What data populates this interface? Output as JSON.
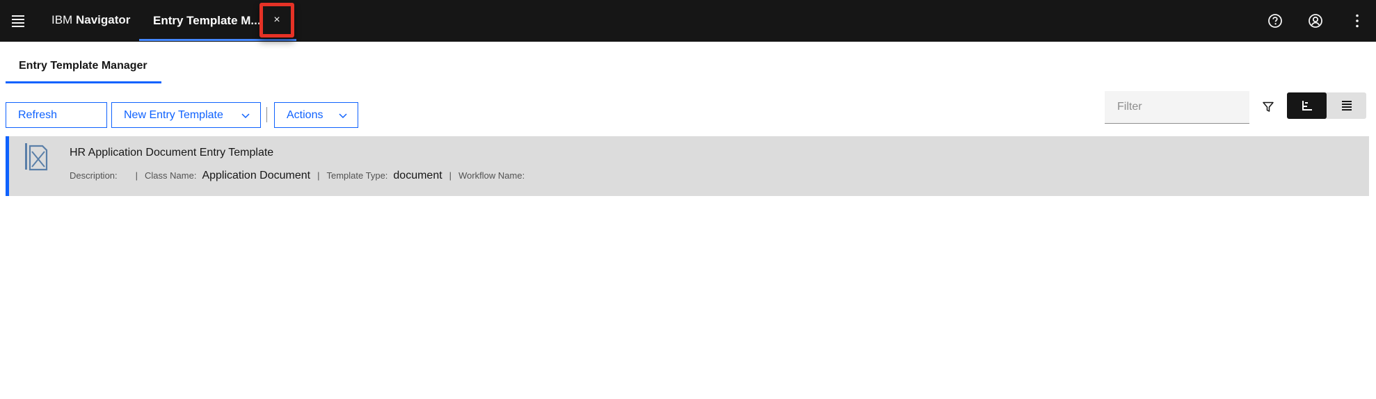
{
  "header": {
    "brand_prefix": "IBM",
    "brand_name": "Navigator",
    "active_tab": "Entry Template M...",
    "close_symbol": "×"
  },
  "page": {
    "tab_title": "Entry Template Manager"
  },
  "toolbar": {
    "refresh_label": "Refresh",
    "new_entry_label": "New Entry Template",
    "actions_label": "Actions",
    "filter_placeholder": "Filter"
  },
  "items": [
    {
      "title": "HR Application Document Entry Template",
      "description_label": "Description:",
      "description_value": "",
      "class_label": "Class Name:",
      "class_value": "Application Document",
      "type_label": "Template Type:",
      "type_value": "document",
      "workflow_label": "Workflow Name:",
      "workflow_value": "",
      "separator": "|"
    }
  ],
  "icons": {
    "menu": "hamburger-menu-icon",
    "help": "help-icon",
    "user": "user-avatar-icon",
    "overflow": "overflow-menu-icon",
    "filter": "filter-icon",
    "details_view": "details-view-icon",
    "list_view": "list-view-icon",
    "entry_template": "entry-template-icon"
  },
  "colors": {
    "header_bg": "#161616",
    "accent": "#0f62fe",
    "highlight": "#e53226",
    "row_bg": "#dcdcdc"
  }
}
